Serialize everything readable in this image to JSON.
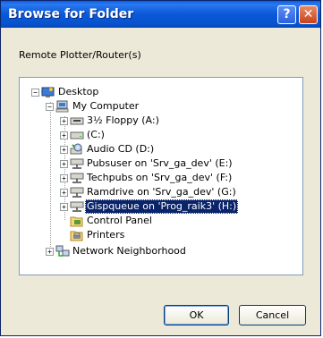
{
  "window": {
    "title": "Browse for Folder"
  },
  "description": "Remote Plotter/Router(s)",
  "tree": {
    "desktop": {
      "label": "Desktop"
    },
    "my_computer": {
      "label": "My Computer"
    },
    "drives": [
      {
        "label": "3½ Floppy (A:)",
        "icon": "floppy-drive-icon"
      },
      {
        "label": "(C:)",
        "icon": "hard-drive-icon"
      },
      {
        "label": "Audio CD (D:)",
        "icon": "cd-drive-icon"
      },
      {
        "label": "Pubsuser on 'Srv_ga_dev' (E:)",
        "icon": "network-drive-icon"
      },
      {
        "label": "Techpubs on 'Srv_ga_dev' (F:)",
        "icon": "network-drive-icon"
      },
      {
        "label": "Ramdrive on 'Srv_ga_dev' (G:)",
        "icon": "network-drive-icon"
      },
      {
        "label": "Gispqueue on 'Prog_raik3' (H:)",
        "icon": "network-drive-icon",
        "selected": true
      },
      {
        "label": "Control Panel",
        "icon": "control-panel-icon"
      },
      {
        "label": "Printers",
        "icon": "printers-icon"
      }
    ],
    "network": {
      "label": "Network Neighborhood"
    }
  },
  "buttons": {
    "ok": "OK",
    "cancel": "Cancel"
  }
}
